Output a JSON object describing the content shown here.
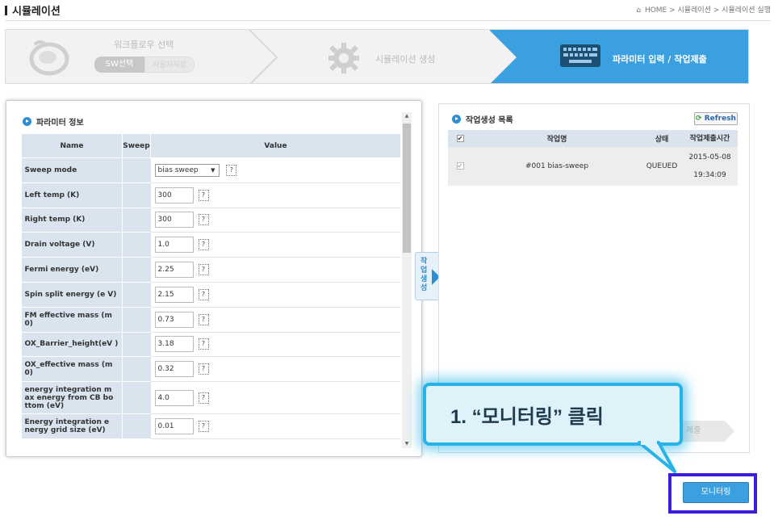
{
  "header": {
    "title": "시뮬레이션",
    "breadcrumb": "HOME > 시뮬레이션 > 시뮬레이션 실행"
  },
  "steps": {
    "step1_label": "워크플로우 선택",
    "step1_btn_sw": "SW선택",
    "step1_btn_other": "사용자지정",
    "step2_label": "시뮬레이션 생성",
    "step3_label": "파라미터 입력 / 작업제출"
  },
  "param_panel": {
    "title": "파라미터 정보",
    "columns": [
      "Name",
      "Sweep",
      "Value"
    ],
    "rows": [
      {
        "name": "Sweep mode",
        "type": "select",
        "value": "bias sweep"
      },
      {
        "name": "Left temp (K)",
        "type": "input",
        "value": "300"
      },
      {
        "name": "Right temp (K)",
        "type": "input",
        "value": "300"
      },
      {
        "name": "Drain voltage (V)",
        "type": "input",
        "value": "1.0"
      },
      {
        "name": "Fermi energy (eV)",
        "type": "input",
        "value": "2.25"
      },
      {
        "name": "Spin split energy (e V)",
        "type": "input",
        "value": "2.15"
      },
      {
        "name": "FM effective mass (m 0)",
        "type": "input",
        "value": "0.73"
      },
      {
        "name": "OX_Barrier_height(eV )",
        "type": "input",
        "value": "3.18"
      },
      {
        "name": "OX_effective mass (m 0)",
        "type": "input",
        "value": "0.32"
      },
      {
        "name": "energy integration m ax energy from CB bo ttom (eV)",
        "type": "input",
        "value": "4.0"
      },
      {
        "name": "Energy integration e nergy grid size (eV)",
        "type": "input",
        "value": "0.01"
      }
    ],
    "help_glyph": "?"
  },
  "side_tab": {
    "label": "작업생성"
  },
  "job_panel": {
    "title": "작업생성 목록",
    "refresh_label": "Refresh",
    "columns": [
      "작업명",
      "상태",
      "작업제출시간"
    ],
    "rows": [
      {
        "name": "#001 bias-sweep",
        "status": "QUEUED",
        "date": "2015-05-08",
        "time": "19:34:09"
      }
    ],
    "submit_label": "제출"
  },
  "callout": {
    "text": "1. “모니터링” 클릭"
  },
  "monitor_button": {
    "label": "모니터링"
  },
  "colors": {
    "accent": "#3aa0e0",
    "callout_border": "#27b3e8",
    "highlight": "#3b1fd8",
    "table_header": "#d9e4ef"
  }
}
